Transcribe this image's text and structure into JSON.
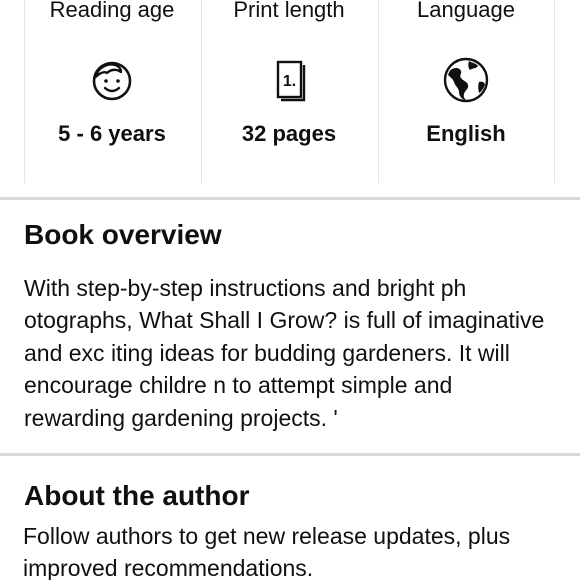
{
  "attributes": [
    {
      "label": "Reading age",
      "icon": "child-face-icon",
      "value": "5 - 6 years"
    },
    {
      "label": "Print length",
      "icon": "book-pages-icon",
      "icon_text": "1.",
      "value": "32 pages"
    },
    {
      "label": "Language",
      "icon": "globe-icon",
      "value": "English"
    }
  ],
  "overview": {
    "title": "Book overview",
    "text": "With step-by-step instructions and bright ph\notographs, What Shall I Grow? is full of imaginative\nand exc iting ideas for budding gardeners. It will\nencourage childre n to attempt simple and\nrewarding gardening projects. '"
  },
  "author": {
    "title": "About the author",
    "text": "Follow authors to get new release updates, plus\nimproved recommendations."
  }
}
